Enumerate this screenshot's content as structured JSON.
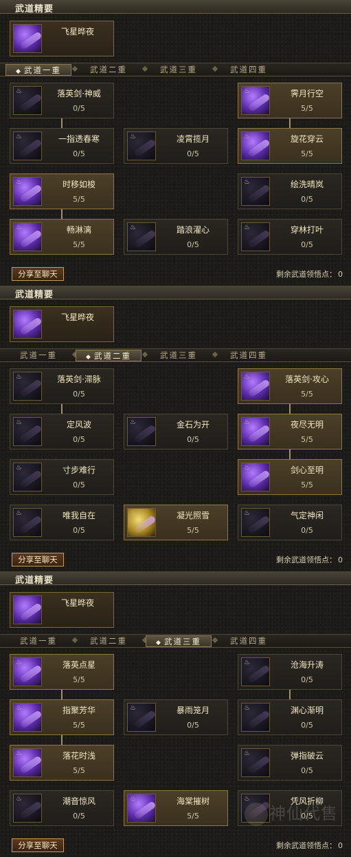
{
  "panels": [
    {
      "header": "武道精要",
      "essence": {
        "name": "飞星晔夜",
        "icon": "purple-swordsman-icon"
      },
      "tabs": [
        "武道一重",
        "武道二重",
        "武道三重",
        "武道四重"
      ],
      "active_tab": 0,
      "share_label": "分享至聊天",
      "remaining_label": "剩余武道领悟点：",
      "remaining_value": "0",
      "skills": [
        {
          "name": "落英剑·神威",
          "level": "0/5",
          "learned": false,
          "icon": "purple-blade-icon"
        },
        {
          "name": "霁月行空",
          "level": "5/5",
          "learned": true,
          "icon": "purple-figure-icon"
        },
        {
          "name": "一指透春寒",
          "level": "0/5",
          "learned": false,
          "icon": "purple-blade-icon"
        },
        {
          "name": "凌霄揽月",
          "level": "0/5",
          "learned": false,
          "icon": "swirl-vortex-icon"
        },
        {
          "name": "旋花穿云",
          "level": "5/5",
          "learned": true,
          "icon": "purple-blade-icon"
        },
        {
          "name": "时移如梭",
          "level": "5/5",
          "learned": true,
          "icon": "purple-moon-blade-icon"
        },
        {
          "name": "绘洗晴岚",
          "level": "0/5",
          "learned": false,
          "icon": "purple-blade-icon"
        },
        {
          "name": "畅淋漓",
          "level": "5/5",
          "learned": true,
          "icon": "purple-blade-icon"
        },
        {
          "name": "踏浪濯心",
          "level": "0/5",
          "learned": false,
          "icon": "purple-blade-icon"
        },
        {
          "name": "穿林打叶",
          "level": "0/5",
          "learned": false,
          "icon": "purple-blade-icon"
        }
      ]
    },
    {
      "header": "武道精要",
      "essence": {
        "name": "飞星晔夜",
        "icon": "purple-swordsman-icon"
      },
      "tabs": [
        "武道一重",
        "武道二重",
        "武道三重",
        "武道四重"
      ],
      "active_tab": 1,
      "share_label": "分享至聊天",
      "remaining_label": "剩余武道领悟点：",
      "remaining_value": "0",
      "skills": [
        {
          "name": "落英剑·滞脉",
          "level": "0/5",
          "learned": false,
          "icon": "purple-blade-icon"
        },
        {
          "name": "落英剑·攻心",
          "level": "5/5",
          "learned": true,
          "icon": "purple-blade-icon"
        },
        {
          "name": "定风波",
          "level": "0/5",
          "learned": false,
          "icon": "purple-swirl-icon"
        },
        {
          "name": "金石为开",
          "level": "0/5",
          "learned": false,
          "icon": "purple-blade-icon"
        },
        {
          "name": "夜尽无明",
          "level": "5/5",
          "learned": true,
          "icon": "purple-rays-icon"
        },
        {
          "name": "寸步难行",
          "level": "0/5",
          "learned": false,
          "icon": "purple-swirl-icon"
        },
        {
          "name": "剑心至明",
          "level": "5/5",
          "learned": true,
          "icon": "purple-blade-icon"
        },
        {
          "name": "唯我自在",
          "level": "0/5",
          "learned": false,
          "icon": "dark-warrior-icon"
        },
        {
          "name": "凝光照雪",
          "level": "5/5",
          "learned": true,
          "icon": "golden-light-icon"
        },
        {
          "name": "气定神闲",
          "level": "0/5",
          "learned": false,
          "icon": "meditating-monk-icon"
        }
      ]
    },
    {
      "header": "武道精要",
      "essence": {
        "name": "飞星晔夜",
        "icon": "purple-swordsman-icon"
      },
      "tabs": [
        "武道一重",
        "武道二重",
        "武道三重",
        "武道四重"
      ],
      "active_tab": 2,
      "share_label": "分享至聊天",
      "remaining_label": "剩余武道领悟点：",
      "remaining_value": "0",
      "skills": [
        {
          "name": "落英点星",
          "level": "5/5",
          "learned": true,
          "icon": "purple-moon-blade-icon"
        },
        {
          "name": "沧海升涛",
          "level": "0/5",
          "learned": false,
          "icon": "purple-blade-icon"
        },
        {
          "name": "指聚芳华",
          "level": "5/5",
          "learned": true,
          "icon": "purple-blade-icon"
        },
        {
          "name": "暴雨笼月",
          "level": "0/5",
          "learned": false,
          "icon": "purple-rays-icon"
        },
        {
          "name": "渊心渐明",
          "level": "0/5",
          "learned": false,
          "icon": "purple-blade-icon"
        },
        {
          "name": "落花时浅",
          "level": "5/5",
          "learned": true,
          "icon": "purple-moon-blade-icon"
        },
        {
          "name": "弹指破云",
          "level": "0/5",
          "learned": false,
          "icon": "purple-blade-icon"
        },
        {
          "name": "潮音惊风",
          "level": "0/5",
          "learned": false,
          "icon": "purple-swirl-icon"
        },
        {
          "name": "海棠摧树",
          "level": "5/5",
          "learned": true,
          "icon": "purple-blade-icon"
        },
        {
          "name": "凭风折柳",
          "level": "0/5",
          "learned": false,
          "icon": "purple-blade-icon"
        }
      ]
    }
  ],
  "watermark": "神仙代售"
}
